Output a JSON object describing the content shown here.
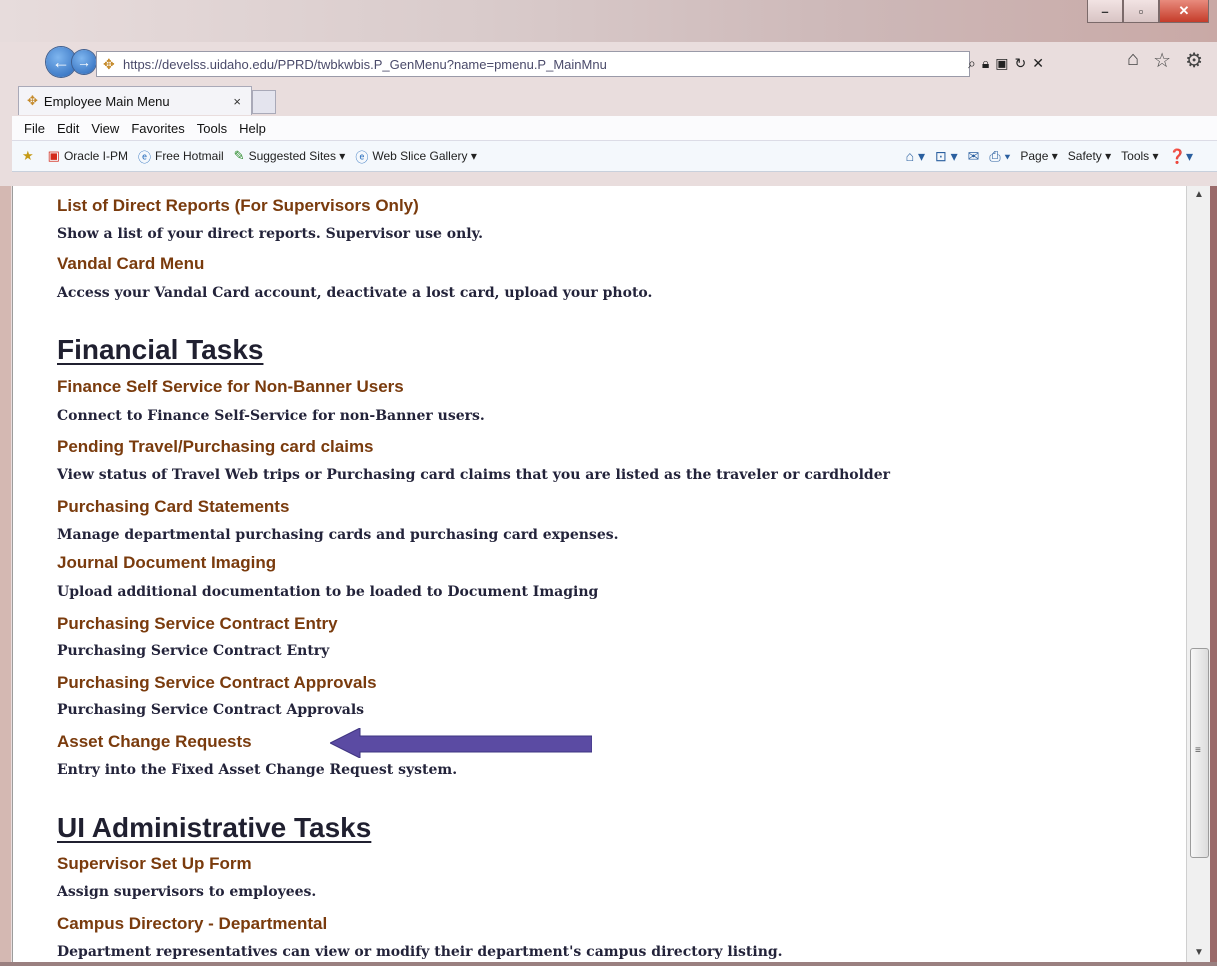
{
  "browser": {
    "url": "https://develss.uidaho.edu/PPRD/twbkwbis.P_GenMenu?name=pmenu.P_MainMnu",
    "tab_title": "Employee Main Menu",
    "tab_close": "×",
    "menus": [
      "File",
      "Edit",
      "View",
      "Favorites",
      "Tools",
      "Help"
    ],
    "favorites": [
      "Oracle I-PM",
      "Free Hotmail",
      "Suggested Sites ▾",
      "Web Slice Gallery ▾"
    ],
    "commands": [
      "Page ▾",
      "Safety ▾",
      "Tools ▾"
    ]
  },
  "content": {
    "top_items": [
      {
        "title": "List of Direct Reports (For Supervisors Only)",
        "desc": "Show a list of your direct reports. Supervisor use only."
      },
      {
        "title": "Vandal Card Menu",
        "desc": "Access your Vandal Card account, deactivate a lost card, upload your photo."
      }
    ],
    "financial": {
      "heading": "Financial Tasks",
      "items": [
        {
          "title": "Finance Self Service for Non-Banner Users",
          "desc": "Connect to Finance Self-Service for non-Banner users."
        },
        {
          "title": "Pending Travel/Purchasing card claims",
          "desc": "View status of Travel Web trips or Purchasing card claims that you are listed as the traveler or cardholder"
        },
        {
          "title": "Purchasing Card Statements",
          "desc": "Manage departmental purchasing cards and purchasing card expenses."
        },
        {
          "title": "Journal Document Imaging",
          "desc": "Upload additional documentation to be loaded to Document Imaging"
        },
        {
          "title": "Purchasing Service Contract Entry",
          "desc": "Purchasing Service Contract Entry"
        },
        {
          "title": "Purchasing Service Contract Approvals",
          "desc": "Purchasing Service Contract Approvals"
        },
        {
          "title": "Asset Change Requests",
          "desc": "Entry into the Fixed Asset Change Request system."
        }
      ]
    },
    "admin": {
      "heading": "UI Administrative Tasks",
      "items": [
        {
          "title": "Supervisor Set Up Form",
          "desc": "Assign supervisors to employees."
        },
        {
          "title": "Campus Directory - Departmental",
          "desc": "Department representatives can view or modify their department's campus directory listing."
        }
      ]
    }
  },
  "colors": {
    "link": "#7a3b0d",
    "desc": "#23233a",
    "arrow": "#5b4ba3"
  }
}
